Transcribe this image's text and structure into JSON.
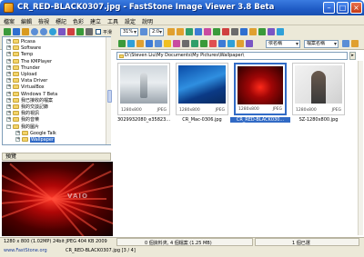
{
  "window": {
    "title": "CR_RED-BLACK0307.jpg - FastStone Image Viewer 3.8 Beta"
  },
  "menu": [
    "檔案",
    "編輯",
    "檢視",
    "標記",
    "色彩",
    "建立",
    "工具",
    "設定",
    "說明"
  ],
  "toolbar": {
    "zoom_value": "31%",
    "zoom_step": "2:0",
    "checkbox_label": "平滑",
    "sort_value": "依名稱",
    "view_value": "檔案名稱"
  },
  "tree": {
    "items": [
      {
        "label": "Picasa",
        "indent": 0,
        "expanded": false,
        "selected": false
      },
      {
        "label": "Software",
        "indent": 0,
        "expanded": false,
        "selected": false
      },
      {
        "label": "Temp",
        "indent": 0,
        "expanded": false,
        "selected": false
      },
      {
        "label": "The KMPlayer",
        "indent": 0,
        "expanded": false,
        "selected": false
      },
      {
        "label": "Thunder",
        "indent": 0,
        "expanded": false,
        "selected": false
      },
      {
        "label": "Upload",
        "indent": 0,
        "expanded": false,
        "selected": false
      },
      {
        "label": "Vista Driver",
        "indent": 0,
        "expanded": false,
        "selected": false
      },
      {
        "label": "VirtualBox",
        "indent": 0,
        "expanded": false,
        "selected": false
      },
      {
        "label": "Windows 7 Beta",
        "indent": 0,
        "expanded": false,
        "selected": false
      },
      {
        "label": "我已接收的檔案",
        "indent": 0,
        "expanded": false,
        "selected": false
      },
      {
        "label": "我的交談記錄",
        "indent": 0,
        "expanded": false,
        "selected": false
      },
      {
        "label": "我的視訊",
        "indent": 0,
        "expanded": false,
        "selected": false
      },
      {
        "label": "我的音樂",
        "indent": 0,
        "expanded": false,
        "selected": false
      },
      {
        "label": "我的圖片",
        "indent": 0,
        "expanded": true,
        "selected": false
      },
      {
        "label": "Google Talk",
        "indent": 1,
        "expanded": false,
        "selected": false
      },
      {
        "label": "Wallpaper",
        "indent": 1,
        "expanded": false,
        "selected": true
      }
    ]
  },
  "preview": {
    "label": "預覽",
    "watermark": "VAIO"
  },
  "address": {
    "path": "D:\\Steven Liu\\My Documents\\My Pictures\\Wallpaper\\"
  },
  "thumbnails": [
    {
      "caption": "3029932080_e35823...",
      "dims": "1280x800",
      "format": "JPEG",
      "selected": false
    },
    {
      "caption": "CR_Mac-0306.jpg",
      "dims": "1280x800",
      "format": "JPEG",
      "selected": false
    },
    {
      "caption": "CR_RED-BLACK030...",
      "dims": "1280x800",
      "format": "JPEG",
      "selected": true
    },
    {
      "caption": "SZ-1280x800.jpg",
      "dims": "1280x800",
      "format": "JPEG",
      "selected": false
    }
  ],
  "status": {
    "image_info": "1280 x 800 (1.02MP)   24bit JPEG   404 KB   2009",
    "website": "www.FastStone.org",
    "file_index": "CR_RED-BLACK0307.jpg [3 / 4]",
    "folder_summary": "0 個資料夾, 4 個檔案 (1.25 MB)",
    "selection": "1 個已選"
  },
  "colors": {
    "titlebar": "#1f5bc5",
    "selection": "#316ac5",
    "chrome": "#ece9d8"
  }
}
